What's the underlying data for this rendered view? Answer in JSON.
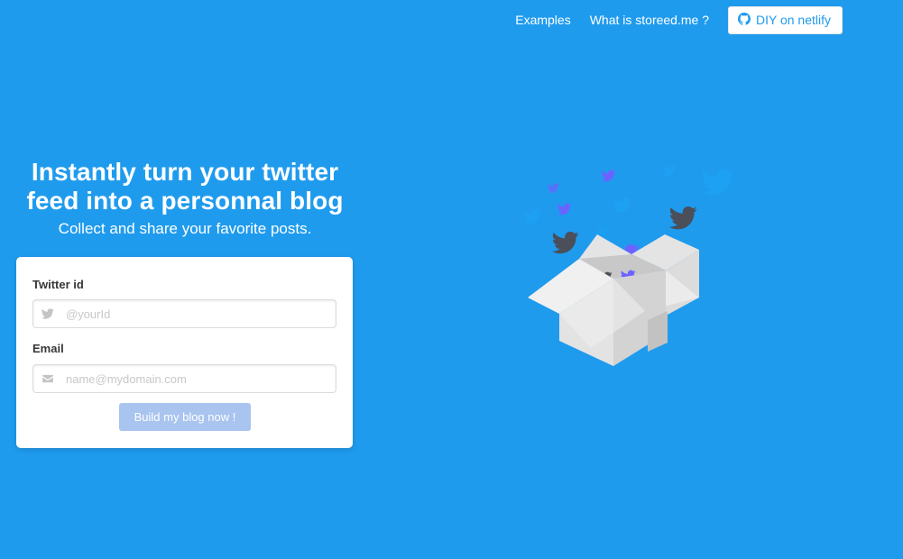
{
  "nav": {
    "examples_label": "Examples",
    "about_label": "What is storeed.me ?",
    "diy_label": "DIY on netlify",
    "diy_icon": "github-icon"
  },
  "hero": {
    "title": "Instantly turn your twitter feed into a personnal blog",
    "subtitle": "Collect and share your favorite posts."
  },
  "form": {
    "twitter_label": "Twitter id",
    "twitter_placeholder": "@yourId",
    "twitter_icon": "twitter-icon",
    "email_label": "Email",
    "email_placeholder": "name@mydomain.com",
    "email_icon": "envelope-icon",
    "submit_label": "Build my blog now !"
  },
  "colors": {
    "background": "#1f9bee",
    "button_disabled": "#a9c4ef",
    "bird_dark": "#4a4f5a",
    "bird_purple": "#6c63ff",
    "bird_blue": "#1da1f2"
  },
  "illustration": {
    "icon": "box-with-twitter-birds-illustration"
  }
}
